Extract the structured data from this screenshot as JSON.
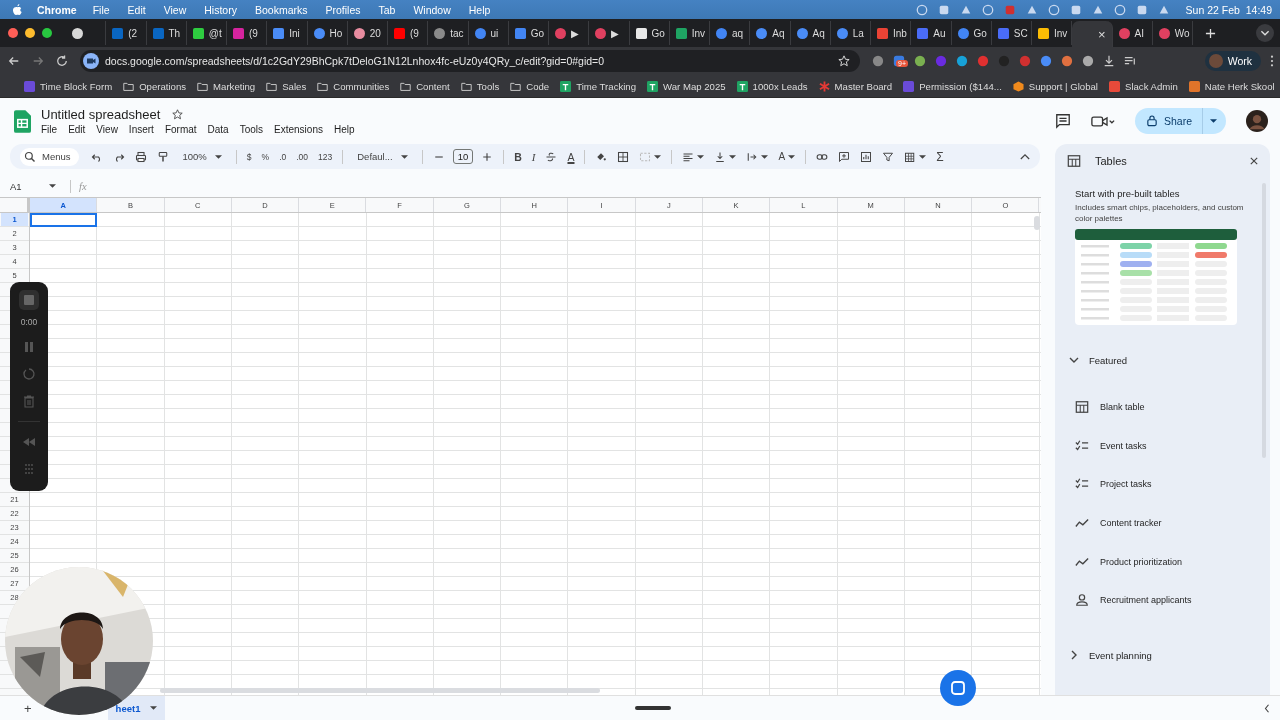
{
  "menu_bar": {
    "app": "Chrome",
    "items": [
      "File",
      "Edit",
      "View",
      "History",
      "Bookmarks",
      "Profiles",
      "Tab",
      "Window",
      "Help"
    ],
    "clock": "Sun 22 Feb  14:49"
  },
  "tabs": [
    {
      "selected": false
    },
    {
      "title": "(2",
      "selected": false
    },
    {
      "title": "Th",
      "selected": false
    },
    {
      "title": "@t",
      "selected": false
    },
    {
      "title": "(9",
      "selected": false
    },
    {
      "title": "Ini",
      "selected": false
    },
    {
      "title": "Ho",
      "selected": false
    },
    {
      "title": "20",
      "selected": false
    },
    {
      "title": "(9",
      "selected": false
    },
    {
      "title": "tac",
      "selected": false
    },
    {
      "title": "ui",
      "selected": false
    },
    {
      "title": "Go",
      "selected": false
    },
    {
      "title": "▶",
      "selected": false
    },
    {
      "title": "▶",
      "selected": false
    },
    {
      "title": "Go",
      "selected": false
    },
    {
      "title": "Inv",
      "selected": false
    },
    {
      "title": "aq",
      "selected": false
    },
    {
      "title": "Aq",
      "selected": false
    },
    {
      "title": "Aq",
      "selected": false
    },
    {
      "title": "La",
      "selected": false
    },
    {
      "title": "Inb",
      "selected": false
    },
    {
      "title": "Au",
      "selected": false
    },
    {
      "title": "Go",
      "selected": false
    },
    {
      "title": "SC",
      "selected": false
    },
    {
      "title": "Inv",
      "selected": false
    },
    {
      "close": "×",
      "selected": true
    },
    {
      "title": "AI",
      "selected": false
    },
    {
      "title": "Wo",
      "selected": false
    }
  ],
  "address_bar": {
    "url": "docs.google.com/spreadsheets/d/1c2GdY29BhCpk7tDeloG1N12Lnhox4fc-eUz0y4QRy_c/edit?gid=0#gid=0",
    "extension_badge": "9+",
    "profile": "Work"
  },
  "bookmarks": [
    {
      "kind": "app",
      "label": "Time Block Form"
    },
    {
      "kind": "folder",
      "label": "Operations"
    },
    {
      "kind": "folder",
      "label": "Marketing"
    },
    {
      "kind": "folder",
      "label": "Sales"
    },
    {
      "kind": "folder",
      "label": "Communities"
    },
    {
      "kind": "folder",
      "label": "Content"
    },
    {
      "kind": "folder",
      "label": "Tools"
    },
    {
      "kind": "folder",
      "label": "Code"
    },
    {
      "kind": "sheet",
      "label": "Time Tracking"
    },
    {
      "kind": "sheet",
      "label": "War Map 2025"
    },
    {
      "kind": "sheet",
      "label": "1000x Leads"
    },
    {
      "kind": "star",
      "label": "Master Board"
    },
    {
      "kind": "app",
      "label": "Permission ($144..."
    },
    {
      "kind": "box",
      "label": "Support | Global"
    },
    {
      "kind": "app",
      "label": "Slack Admin"
    },
    {
      "kind": "app",
      "label": "Nate Herk Skool"
    }
  ],
  "sheets": {
    "title": "Untitled spreadsheet",
    "menus": [
      "File",
      "Edit",
      "View",
      "Insert",
      "Format",
      "Data",
      "Tools",
      "Extensions",
      "Help"
    ],
    "share": "Share"
  },
  "toolbar": {
    "groups": [
      [
        {
          "kind": "search",
          "label": "Menus"
        },
        {
          "kind": "undo"
        },
        {
          "kind": "redo"
        },
        {
          "kind": "print"
        },
        {
          "kind": "paint"
        },
        {
          "kind": "dropdown",
          "label": "100%"
        }
      ],
      [
        {
          "kind": "text",
          "label": "$"
        },
        {
          "kind": "text",
          "label": "%"
        },
        {
          "kind": "text",
          "label": ".0"
        },
        {
          "kind": "text",
          "label": ".00"
        },
        {
          "kind": "text",
          "label": "123"
        }
      ],
      [
        {
          "kind": "dropdown",
          "label": "Defaul..."
        }
      ],
      [
        {
          "kind": "minus"
        },
        {
          "kind": "size",
          "label": "10"
        },
        {
          "kind": "plus"
        }
      ],
      [
        {
          "kind": "bold",
          "label": "B"
        },
        {
          "kind": "italic",
          "label": "I"
        },
        {
          "kind": "strike"
        },
        {
          "kind": "textcolor",
          "label": "A"
        }
      ],
      [
        {
          "kind": "fill"
        },
        {
          "kind": "borders"
        },
        {
          "kind": "merge"
        }
      ],
      [
        {
          "kind": "align"
        },
        {
          "kind": "valign"
        },
        {
          "kind": "wrap"
        },
        {
          "kind": "rotate",
          "label": "A"
        }
      ],
      [
        {
          "kind": "link"
        },
        {
          "kind": "comment"
        },
        {
          "kind": "chart"
        },
        {
          "kind": "filter"
        },
        {
          "kind": "views"
        },
        {
          "kind": "functions",
          "label": "Σ"
        }
      ]
    ]
  },
  "formula_bar": {
    "cell": "A1",
    "fx": "fx"
  },
  "grid": {
    "columns": [
      {
        "label": "A",
        "selected": true
      },
      {
        "label": "B",
        "selected": false
      },
      {
        "label": "C",
        "selected": false
      },
      {
        "label": "D",
        "selected": false
      },
      {
        "label": "E",
        "selected": false
      },
      {
        "label": "F",
        "selected": false
      },
      {
        "label": "G",
        "selected": false
      },
      {
        "label": "H",
        "selected": false
      },
      {
        "label": "I",
        "selected": false
      },
      {
        "label": "J",
        "selected": false
      },
      {
        "label": "K",
        "selected": false
      },
      {
        "label": "L",
        "selected": false
      },
      {
        "label": "M",
        "selected": false
      },
      {
        "label": "N",
        "selected": false
      },
      {
        "label": "O",
        "selected": false
      }
    ],
    "rows_top": [
      {
        "label": "1",
        "selected": true
      },
      {
        "label": "2",
        "selected": false
      },
      {
        "label": "3",
        "selected": false
      },
      {
        "label": "4",
        "selected": false
      },
      {
        "label": "5",
        "selected": false
      }
    ],
    "rows_bottom": [
      {
        "label": "21",
        "selected": false
      },
      {
        "label": "22",
        "selected": false
      },
      {
        "label": "23",
        "selected": false
      },
      {
        "label": "24",
        "selected": false
      },
      {
        "label": "25",
        "selected": false
      },
      {
        "label": "26",
        "selected": false
      },
      {
        "label": "27",
        "selected": false
      },
      {
        "label": "28",
        "selected": false
      }
    ]
  },
  "recorder": {
    "time": "0:00"
  },
  "tables_panel": {
    "title": "Tables",
    "heading": "Start with pre-built tables",
    "description": "Includes smart chips, placeholders, and custom color palettes",
    "sections": [
      {
        "title": "Featured",
        "expanded": true,
        "items": [
          {
            "kind": "table",
            "label": "Blank table"
          },
          {
            "kind": "checklist",
            "label": "Event tasks"
          },
          {
            "kind": "checklist",
            "label": "Project tasks"
          },
          {
            "kind": "trend",
            "label": "Content tracker"
          },
          {
            "kind": "trend",
            "label": "Product prioritization"
          },
          {
            "kind": "person",
            "label": "Recruitment applicants"
          }
        ]
      },
      {
        "title": "Event planning",
        "expanded": false
      }
    ]
  },
  "sheet_bar": {
    "add": "+",
    "tabs": [
      {
        "label": "heet1",
        "selected": true
      }
    ]
  }
}
